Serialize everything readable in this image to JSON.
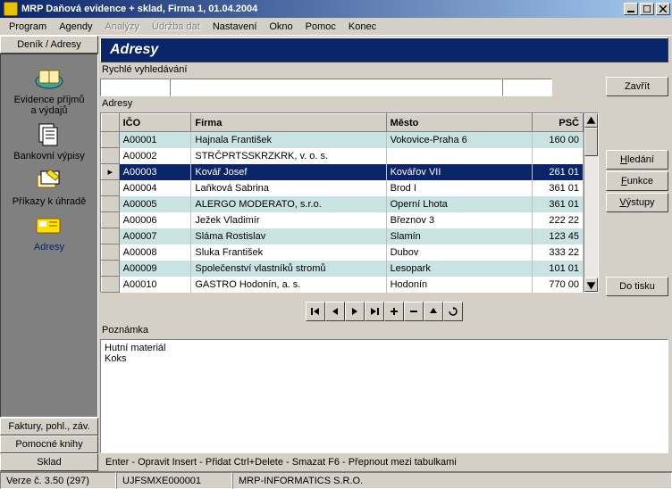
{
  "window": {
    "title": "MRP Daňová evidence + sklad,  Firma 1,  01.04.2004"
  },
  "menu": {
    "items": [
      {
        "label": "Program",
        "enabled": true
      },
      {
        "label": "Agendy",
        "enabled": true
      },
      {
        "label": "Analýzy",
        "enabled": false
      },
      {
        "label": "Údržba dat",
        "enabled": false
      },
      {
        "label": "Nastavení",
        "enabled": true
      },
      {
        "label": "Okno",
        "enabled": true
      },
      {
        "label": "Pomoc",
        "enabled": true
      },
      {
        "label": "Konec",
        "enabled": true
      }
    ]
  },
  "sidebar": {
    "top_tab": "Deník / Adresy",
    "items": [
      {
        "label": "Evidence příjmů\na výdajů",
        "icon": "ledger-icon"
      },
      {
        "label": "Bankovní výpisy",
        "icon": "docs-icon"
      },
      {
        "label": "Příkazy k úhradě",
        "icon": "money-icon"
      },
      {
        "label": "Adresy",
        "icon": "card-icon"
      }
    ],
    "active_index": 3,
    "bottom_tabs": [
      "Faktury, pohl., záv.",
      "Pomocné knihy",
      "Sklad"
    ]
  },
  "main": {
    "header": "Adresy",
    "search_label": "Rychlé vyhledávání",
    "grid_label": "Adresy",
    "columns": [
      "IČO",
      "Firma",
      "Město",
      "PSČ"
    ],
    "rows": [
      {
        "ico": "A00001",
        "firma": "Hajnala František",
        "mesto": "Vokovice-Praha 6",
        "psc": "160 00"
      },
      {
        "ico": "A00002",
        "firma": "STRČPRTSSKRZKRK, v. o. s.",
        "mesto": "",
        "psc": ""
      },
      {
        "ico": "A00003",
        "firma": "Kovář Josef",
        "mesto": "Kovářov VII",
        "psc": "261 01"
      },
      {
        "ico": "A00004",
        "firma": "Laňková Sabrina",
        "mesto": "Brod I",
        "psc": "361 01"
      },
      {
        "ico": "A00005",
        "firma": "ALERGO MODERATO, s.r.o.",
        "mesto": "Operní Lhota",
        "psc": "361 01"
      },
      {
        "ico": "A00006",
        "firma": "Ježek Vladimír",
        "mesto": "Březnov 3",
        "psc": "222 22"
      },
      {
        "ico": "A00007",
        "firma": "Sláma Rostislav",
        "mesto": "Slamín",
        "psc": "123 45"
      },
      {
        "ico": "A00008",
        "firma": "Sluka František",
        "mesto": "Dubov",
        "psc": "333 22"
      },
      {
        "ico": "A00009",
        "firma": "Společenství vlastníků stromů",
        "mesto": "Lesopark",
        "psc": "101 01"
      },
      {
        "ico": "A00010",
        "firma": "GASTRO Hodonín, a. s.",
        "mesto": "Hodonín",
        "psc": "770 00"
      }
    ],
    "selected_index": 2,
    "note_label": "Poznámka",
    "note_text": "Hutní materiál\nKoks",
    "hint": "Enter - Opravit   Insert - Přidat   Ctrl+Delete - Smazat   F6 - Přepnout mezi tabulkami"
  },
  "buttons": {
    "close": "Zavřít",
    "search": {
      "u": "H",
      "rest": "ledání"
    },
    "funcs": {
      "u": "F",
      "rest": "unkce"
    },
    "out": {
      "u": "V",
      "rest": "ýstupy"
    },
    "print": "Do tisku"
  },
  "status": {
    "version": "Verze č. 3.50 (297)",
    "code": "UJFSMXE000001",
    "company": "MRP-INFORMATICS S.R.O."
  }
}
